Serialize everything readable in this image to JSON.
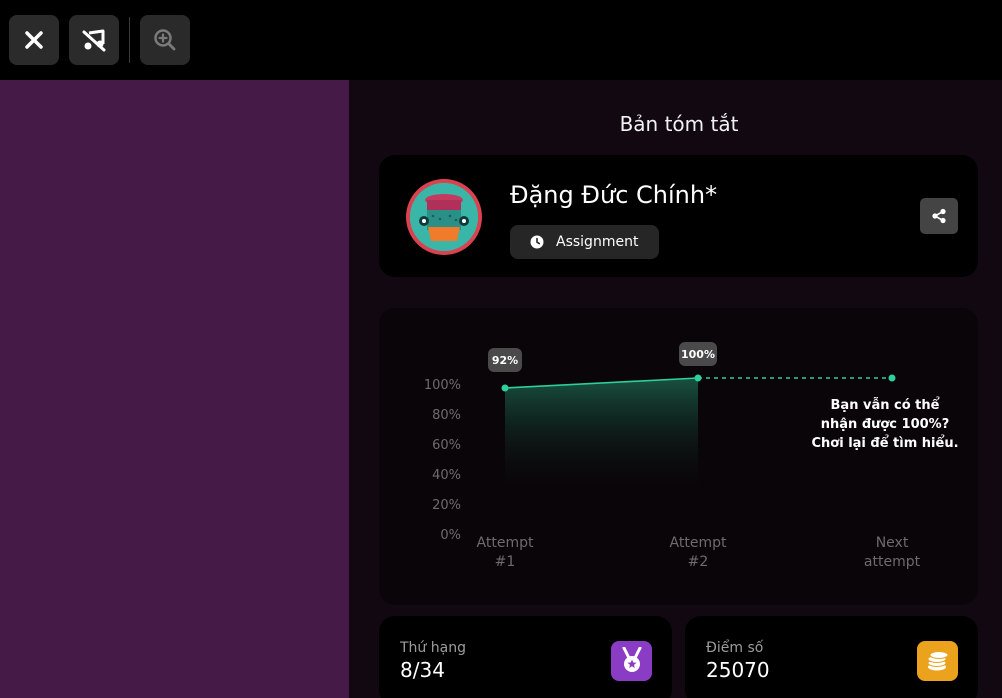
{
  "toolbar": {
    "close_icon": "close-icon",
    "music_off_icon": "music-off-icon",
    "zoom_in_icon": "zoom-in-icon"
  },
  "summary": {
    "title": "Bản tóm tắt"
  },
  "profile": {
    "name": "Đặng Đức Chính*",
    "mode_label": "Assignment",
    "mode_icon": "clock-icon",
    "share_icon": "share-icon"
  },
  "chart_data": {
    "type": "line",
    "categories": [
      "Attempt\n#1",
      "Attempt\n#2",
      "Next\nattempt"
    ],
    "series": [
      {
        "values": [
          92,
          100,
          null
        ]
      }
    ],
    "projection": {
      "from": "Attempt #2",
      "to": "Next attempt",
      "value": 100,
      "style": "dashed"
    },
    "data_labels": [
      "92%",
      "100%"
    ],
    "y_ticks": [
      "100%",
      "80%",
      "60%",
      "40%",
      "20%",
      "0%"
    ],
    "ylim": [
      0,
      100
    ],
    "line_color": "#2ecf9a",
    "annotation": [
      "Bạn vẫn có thể",
      "nhận được 100%?",
      "Chơi lại để tìm hiểu."
    ]
  },
  "stats": {
    "rank": {
      "label": "Thứ hạng",
      "value": "8/34",
      "icon": "medal-icon",
      "color": "#8a3cc4"
    },
    "score": {
      "label": "Điểm số",
      "value": "25070",
      "icon": "coins-icon",
      "color": "#eba21d"
    }
  }
}
